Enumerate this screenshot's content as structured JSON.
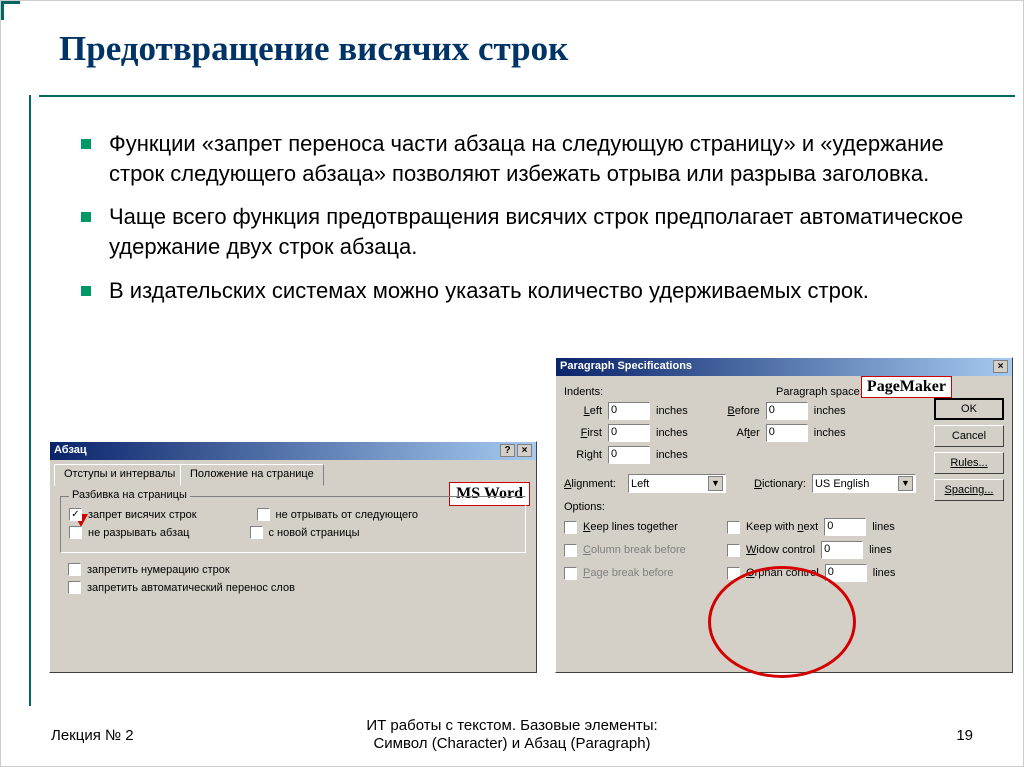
{
  "slide": {
    "title": "Предотвращение висячих строк",
    "bullets": [
      "Функции «запрет переноса части абзаца на следующую страницу» и «удержание строк следующего абзаца» позволяют избежать отрыва или разрыва заголовка.",
      "Чаще всего функция предотвращения висячих строк предполагает автоматическое удержание двух строк абзаца.",
      "В издательских системах можно указать количество удерживаемых строк."
    ]
  },
  "msword": {
    "label": "MS Word",
    "window_title": "Абзац",
    "tabs": [
      "Отступы и интервалы",
      "Положение на странице"
    ],
    "group": "Разбивка на страницы",
    "checks": {
      "widow": {
        "label": "запрет висячих строк",
        "checked": true
      },
      "keep_next": {
        "label": "не отрывать от следующего",
        "checked": false
      },
      "keep_together": {
        "label": "не разрывать абзац",
        "checked": false
      },
      "new_page": {
        "label": "с новой страницы",
        "checked": false
      },
      "no_num": {
        "label": "запретить нумерацию строк",
        "checked": false
      },
      "no_hyph": {
        "label": "запретить автоматический перенос слов",
        "checked": false
      }
    }
  },
  "pm": {
    "label": "PageMaker",
    "window_title": "Paragraph Specifications",
    "buttons": {
      "ok": "OK",
      "cancel": "Cancel",
      "rules": "Rules...",
      "spacing": "Spacing..."
    },
    "indents_label": "Indents:",
    "pspace_label": "Paragraph space:",
    "indents": {
      "left": {
        "label": "Left",
        "value": "0",
        "unit": "inches"
      },
      "first": {
        "label": "First",
        "value": "0",
        "unit": "inches"
      },
      "right": {
        "label": "Right",
        "value": "0",
        "unit": "inches"
      }
    },
    "pspace": {
      "before": {
        "label": "Before",
        "value": "0",
        "unit": "inches"
      },
      "after": {
        "label": "After",
        "value": "0",
        "unit": "inches"
      }
    },
    "alignment": {
      "label": "Alignment:",
      "value": "Left"
    },
    "dictionary": {
      "label": "Dictionary:",
      "value": "US English"
    },
    "options_label": "Options:",
    "options": {
      "keep_lines": {
        "label": "Keep lines together",
        "checked": false
      },
      "col_break": {
        "label": "Column break before",
        "checked": false
      },
      "page_break": {
        "label": "Page break before",
        "checked": false
      },
      "keep_next": {
        "label": "Keep with next",
        "checked": false,
        "value": "0",
        "unit": "lines"
      },
      "widow": {
        "label": "Widow control",
        "checked": false,
        "value": "0",
        "unit": "lines"
      },
      "orphan": {
        "label": "Orphan control",
        "checked": false,
        "value": "0",
        "unit": "lines"
      }
    }
  },
  "footer": {
    "left": "Лекция № 2",
    "center_line1": "ИТ работы с текстом. Базовые элементы:",
    "center_line2": "Символ (Character) и Абзац (Paragraph)",
    "right": "19"
  }
}
